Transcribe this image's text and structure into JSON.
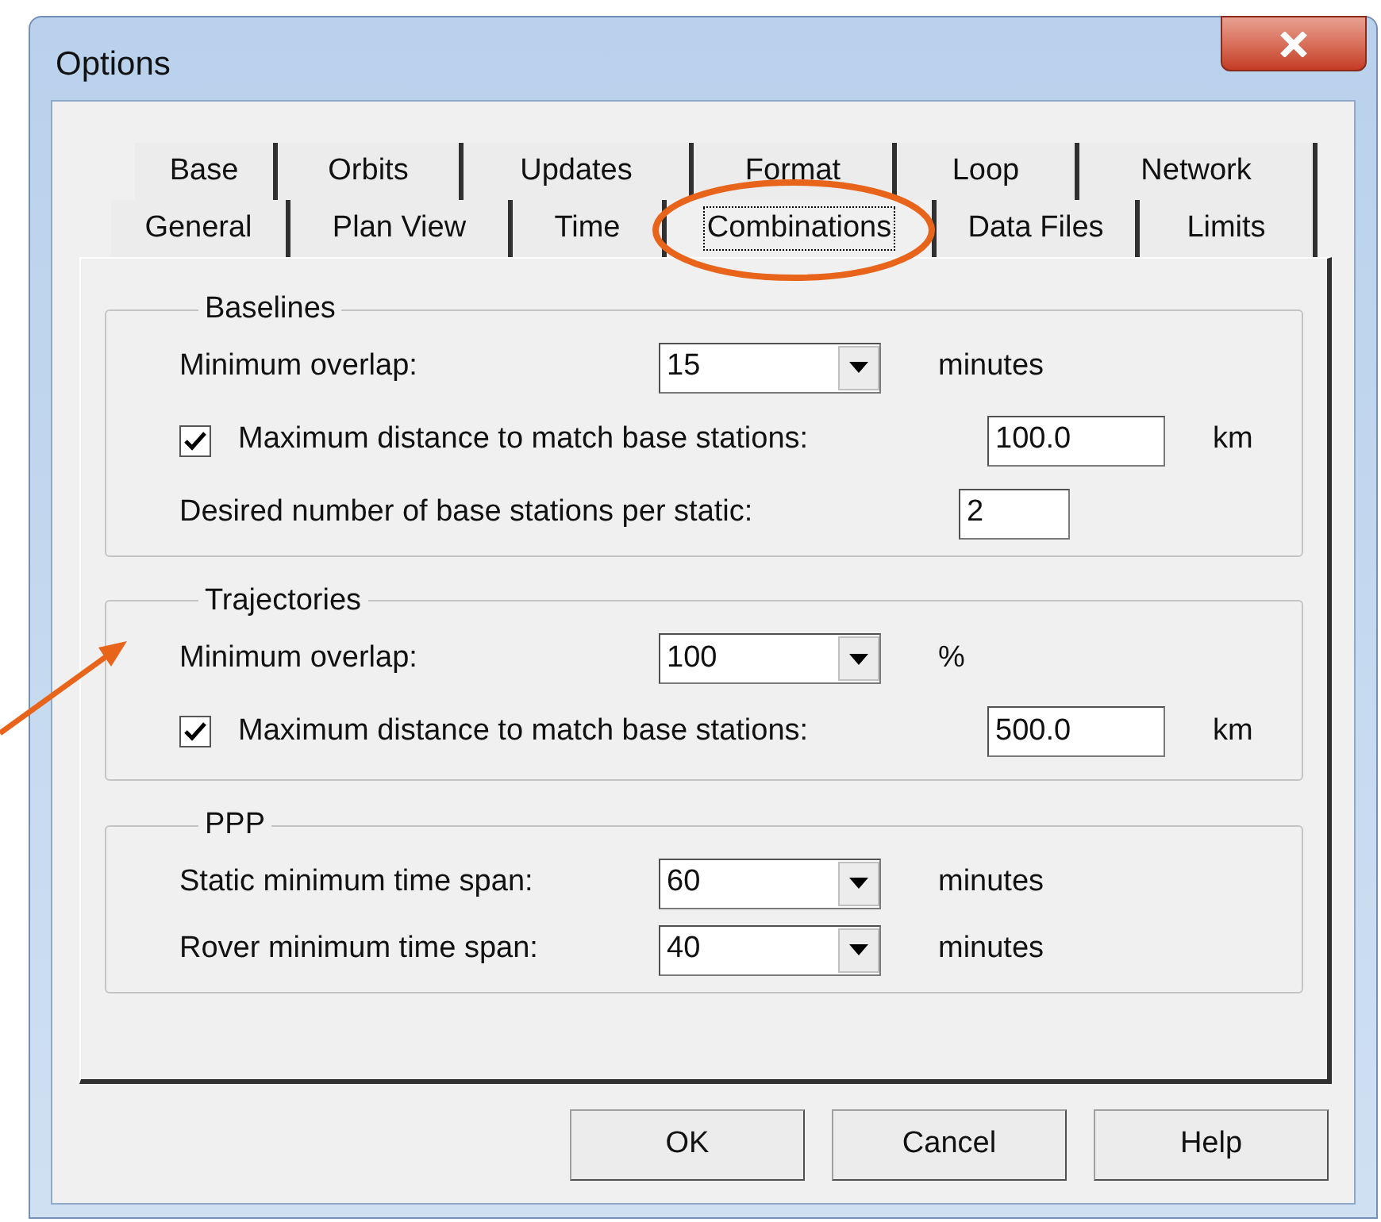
{
  "window": {
    "title": "Options"
  },
  "tab_rows": [
    {
      "tabs": [
        {
          "label": "Base",
          "selected": false,
          "circled": false
        },
        {
          "label": "Orbits",
          "selected": false,
          "circled": false
        },
        {
          "label": "Updates",
          "selected": false,
          "circled": false
        },
        {
          "label": "Format",
          "selected": false,
          "circled": false
        },
        {
          "label": "Loop",
          "selected": false,
          "circled": false
        },
        {
          "label": "Network",
          "selected": false,
          "circled": false
        }
      ]
    },
    {
      "tabs": [
        {
          "label": "General",
          "selected": false,
          "circled": false
        },
        {
          "label": "Plan View",
          "selected": false,
          "circled": false
        },
        {
          "label": "Time",
          "selected": false,
          "circled": false
        },
        {
          "label": "Combinations",
          "selected": true,
          "circled": true
        },
        {
          "label": "Data Files",
          "selected": false,
          "circled": false
        },
        {
          "label": "Limits",
          "selected": false,
          "circled": false
        }
      ]
    }
  ],
  "groups": [
    {
      "title": "Baselines",
      "pointed": false,
      "rows": [
        {
          "kind": "combo",
          "label": "Minimum overlap:",
          "value": "15",
          "unit": "minutes"
        },
        {
          "kind": "check",
          "label": "Maximum distance to match base stations:",
          "checked": true,
          "value": "100.0",
          "unit": "km"
        },
        {
          "kind": "field",
          "label": "Desired number of base stations per static:",
          "value": "2"
        }
      ]
    },
    {
      "title": "Trajectories",
      "pointed": true,
      "rows": [
        {
          "kind": "combo",
          "label": "Minimum overlap:",
          "value": "100",
          "unit": "%"
        },
        {
          "kind": "check",
          "label": "Maximum distance to match base stations:",
          "checked": true,
          "value": "500.0",
          "unit": "km"
        }
      ]
    },
    {
      "title": "PPP",
      "pointed": false,
      "rows": [
        {
          "kind": "combo",
          "label": "Static minimum time span:",
          "value": "60",
          "unit": "minutes"
        },
        {
          "kind": "combo",
          "label": "Rover minimum time span:",
          "value": "40",
          "unit": "minutes"
        }
      ]
    }
  ],
  "buttons": [
    "OK",
    "Cancel",
    "Help"
  ]
}
